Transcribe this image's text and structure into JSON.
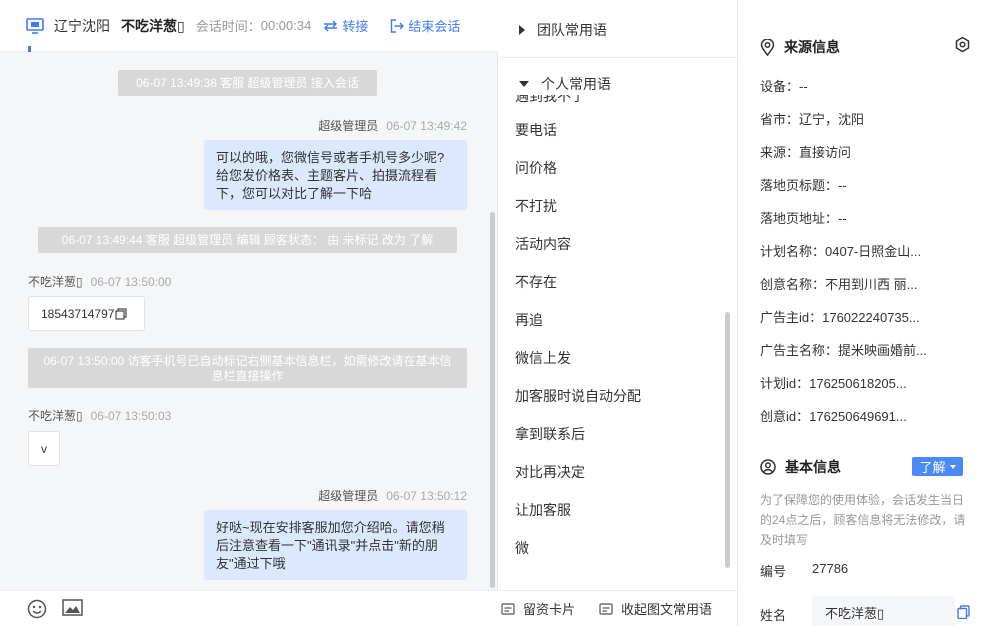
{
  "header": {
    "location": "辽宁沈阳",
    "visitor_name": "不吃洋葱▯",
    "session_time_label": "会话时间：",
    "session_time": "00:00:34",
    "transfer_label": "转接",
    "end_label": "结束会话"
  },
  "messages": {
    "sys1": "06-07 13:49:38 客服 超级管理员 接入会话",
    "m1_sender": "超级管理员",
    "m1_time": "06-07 13:49:42",
    "m1_text": "可以的哦，您微信号或者手机号多少呢?给您发价格表、主题客片、拍摄流程看下，您可以对比了解一下哈",
    "sys2": "06-07 13:49:44 客服 超级管理员 编辑 顾客状态： 由 未标记 改为 了解",
    "m2_sender": "不吃洋葱▯",
    "m2_time": "06-07 13:50:00",
    "m2_text": "18543714797",
    "sys3": "06-07 13:50:00 访客手机号已自动标记右侧基本信息栏，如需修改请在基本信息栏直接操作",
    "m3_sender": "不吃洋葱▯",
    "m3_time": "06-07 13:50:03",
    "m3_text": "v",
    "m4_sender": "超级管理员",
    "m4_time": "06-07 13:50:12",
    "m4_text": "好哒~现在安排客服加您介绍哈。请您稍后注意查看一下\"通讯录\"并点击\"新的朋友\"通过下哦"
  },
  "icons": {
    "monitor": "monitor-icon",
    "transfer": "transfer-icon",
    "end": "exit-icon",
    "copy": "copy-icon",
    "emoji": "emoji-icon",
    "image": "image-icon",
    "card": "card-icon",
    "location": "location-pin-icon",
    "settings": "settings-icon",
    "person": "person-icon"
  },
  "phrases": {
    "team_label": "团队常用语",
    "personal_label": "个人常用语",
    "clipped_item": "遇到我不了",
    "items": [
      "要电话",
      "问价格",
      "不打扰",
      "活动内容",
      "不存在",
      "再追",
      "微信上发",
      "加客服时说自动分配",
      "拿到联系后",
      "对比再决定",
      "让加客服",
      "微"
    ],
    "leave_card": "留资卡片",
    "collapse_label": "收起图文常用语"
  },
  "info": {
    "source_title": "来源信息",
    "rows": [
      "设备：--",
      "省市：辽宁，沈阳",
      "来源：直接访问",
      "落地页标题：--",
      "落地页地址：--",
      "计划名称：0407-日照金山...",
      "创意名称：不用到川西 丽...",
      "广告主id：176022240735...",
      "广告主名称：提米映画婚前...",
      "计划id：176250618205...",
      "创意id：176250649691..."
    ],
    "basic_title": "基本信息",
    "know_label": "了解",
    "note": "为了保障您的使用体验，会话发生当日的24点之后，顾客信息将无法修改，请及时填写",
    "id_label": "编号",
    "id_value": "27786",
    "name_label": "姓名",
    "name_value": "不吃洋葱▯"
  },
  "colors": {
    "accent": "#3c7cf0",
    "bubble_agent": "#dbe8fd",
    "system_msg": "#d8d8d8"
  }
}
